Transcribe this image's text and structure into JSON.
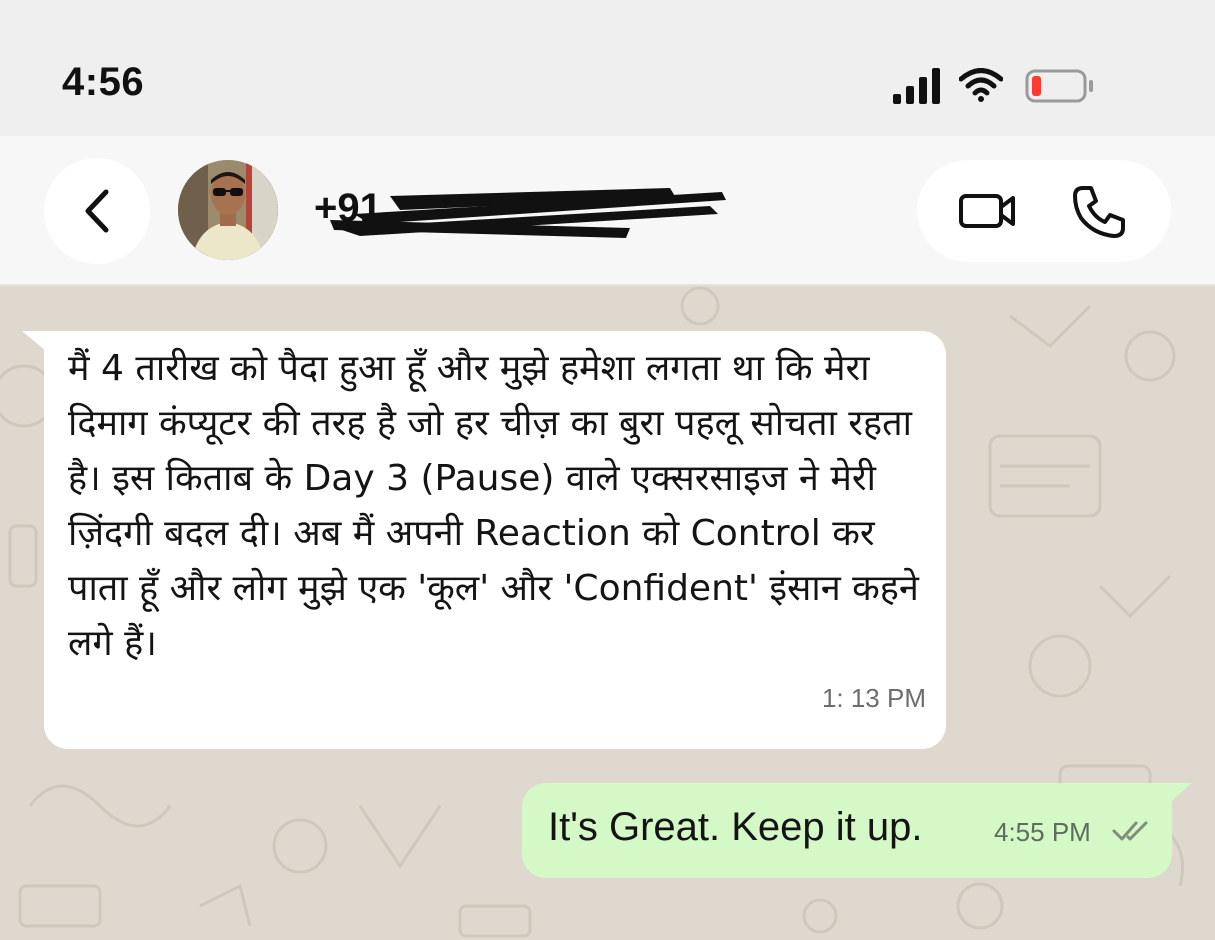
{
  "status_bar": {
    "time": "4:56",
    "icons": [
      "signal-icon",
      "wifi-icon",
      "battery-low-icon"
    ],
    "battery_color": "#ff3b30"
  },
  "header": {
    "back_icon": "chevron-left-icon",
    "contact_name": "+91",
    "actions": [
      "video-call-icon",
      "phone-call-icon"
    ]
  },
  "messages": [
    {
      "direction": "incoming",
      "text": "मैं 4 तारीख को पैदा हुआ हूँ और मुझे हमेशा लगता था कि मेरा दिमाग कंप्यूटर की तरह है जो हर चीज़ का बुरा पहलू सोचता रहता है। इस किताब के Day 3 (Pause) वाले एक्सरसाइज ने मेरी ज़िंदगी बदल दी। अब मैं अपनी Reaction को Control कर पाता हूँ और लोग मुझे एक 'कूल' और 'Confident' इंसान कहने लगे हैं।",
      "time": "1: 13  PM"
    },
    {
      "direction": "outgoing",
      "text": "It's Great. Keep it up.",
      "time": "4:55 PM",
      "status_icon": "double-check-icon"
    }
  ],
  "colors": {
    "chat_background": "#ded8ce",
    "incoming_bubble": "#ffffff",
    "outgoing_bubble": "#d4f8c6",
    "header_background": "#f7f7f7"
  }
}
